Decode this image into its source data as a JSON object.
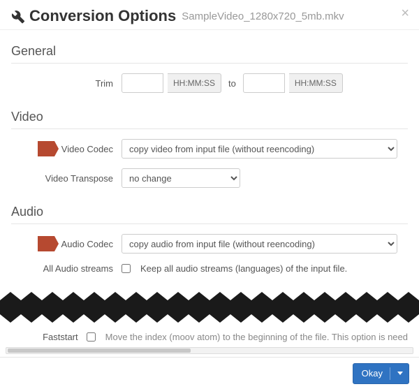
{
  "header": {
    "title": "Conversion Options",
    "filename": "SampleVideo_1280x720_5mb.mkv",
    "close_label": "×"
  },
  "sections": {
    "general": {
      "title": "General"
    },
    "video": {
      "title": "Video"
    },
    "audio": {
      "title": "Audio"
    }
  },
  "trim": {
    "label": "Trim",
    "placeholder_from": "HH:MM:SS",
    "to_label": "to",
    "placeholder_to": "HH:MM:SS"
  },
  "video": {
    "codec_label": "Video Codec",
    "codec_selected": "copy video from input file (without reencoding)",
    "transpose_label": "Video Transpose",
    "transpose_selected": "no change"
  },
  "audio": {
    "codec_label": "Audio Codec",
    "codec_selected": "copy audio from input file (without reencoding)",
    "all_streams_label": "All Audio streams",
    "keep_all_label": "Keep all audio streams (languages) of the input file."
  },
  "faststart": {
    "label": "Faststart",
    "desc": "Move the index (moov atom) to the beginning of the file. This option is need"
  },
  "footer": {
    "okay": "Okay"
  }
}
